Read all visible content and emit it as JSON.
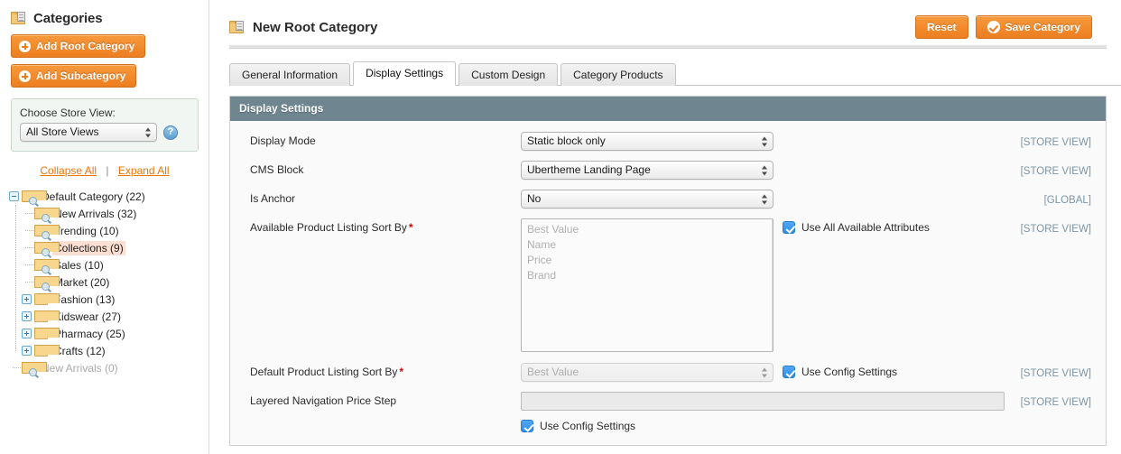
{
  "sidebar": {
    "heading": "Categories",
    "heading_icon": "folder-page-icon",
    "add_root_label": "Add Root Category",
    "add_sub_label": "Add Subcategory",
    "store_view": {
      "label": "Choose Store View:",
      "selected": "All Store Views",
      "options": [
        "All Store Views"
      ],
      "help_icon": "question-mark-icon"
    },
    "collapse_all": "Collapse All",
    "expand_all": "Expand All",
    "separator": "|",
    "tree": [
      {
        "label": "Default Category (22)",
        "depth": 0,
        "expander": "minus",
        "icon": "folder-search-icon",
        "selected": false,
        "muted": false
      },
      {
        "label": "New Arrivals (32)",
        "depth": 1,
        "expander": "none",
        "icon": "folder-search-icon",
        "selected": false,
        "muted": false
      },
      {
        "label": "Trending (10)",
        "depth": 1,
        "expander": "none",
        "icon": "folder-search-icon",
        "selected": false,
        "muted": false
      },
      {
        "label": "Collections (9)",
        "depth": 1,
        "expander": "none",
        "icon": "folder-search-icon",
        "selected": true,
        "muted": false
      },
      {
        "label": "Sales (10)",
        "depth": 1,
        "expander": "none",
        "icon": "folder-search-icon",
        "selected": false,
        "muted": false
      },
      {
        "label": "Market (20)",
        "depth": 1,
        "expander": "none",
        "icon": "folder-search-icon",
        "selected": false,
        "muted": false
      },
      {
        "label": "Fashion (13)",
        "depth": 1,
        "expander": "plus",
        "icon": "folder-icon",
        "selected": false,
        "muted": false
      },
      {
        "label": "Kidswear (27)",
        "depth": 1,
        "expander": "plus",
        "icon": "folder-icon",
        "selected": false,
        "muted": false
      },
      {
        "label": "Pharmacy (25)",
        "depth": 1,
        "expander": "plus",
        "icon": "folder-icon",
        "selected": false,
        "muted": false
      },
      {
        "label": "Crafts (12)",
        "depth": 1,
        "expander": "plus",
        "icon": "folder-icon",
        "selected": false,
        "muted": false
      },
      {
        "label": "New Arrivals (0)",
        "depth": 0,
        "expander": "none",
        "icon": "folder-search-icon",
        "selected": false,
        "muted": true
      }
    ]
  },
  "header": {
    "title": "New Root Category",
    "title_icon": "folder-page-icon",
    "reset_label": "Reset",
    "save_label": "Save Category",
    "save_icon": "check-circle-icon"
  },
  "tabs": [
    {
      "label": "General Information",
      "active": false
    },
    {
      "label": "Display Settings",
      "active": true
    },
    {
      "label": "Custom Design",
      "active": false
    },
    {
      "label": "Category Products",
      "active": false
    }
  ],
  "fieldset": {
    "title": "Display Settings",
    "rows": {
      "display_mode": {
        "label": "Display Mode",
        "value": "Static block only",
        "options": [
          "Static block only"
        ],
        "scope": "[STORE VIEW]"
      },
      "cms_block": {
        "label": "CMS Block",
        "value": "Ubertheme Landing Page",
        "options": [
          "Ubertheme Landing Page"
        ],
        "scope": "[STORE VIEW]"
      },
      "is_anchor": {
        "label": "Is Anchor",
        "value": "No",
        "options": [
          "No"
        ],
        "scope": "[GLOBAL]"
      },
      "available_sort": {
        "label": "Available Product Listing Sort By",
        "required": "*",
        "options": [
          "Best Value",
          "Name",
          "Price",
          "Brand"
        ],
        "checkbox_label": "Use All Available Attributes",
        "checked": true,
        "scope": "[STORE VIEW]"
      },
      "default_sort": {
        "label": "Default Product Listing Sort By",
        "required": "*",
        "value": "Best Value",
        "options": [
          "Best Value"
        ],
        "checkbox_label": "Use Config Settings",
        "checked": true,
        "scope": "[STORE VIEW]"
      },
      "price_step": {
        "label": "Layered Navigation Price Step",
        "value": "",
        "placeholder": "",
        "checkbox_label": "Use Config Settings",
        "checked": true,
        "scope": "[STORE VIEW]"
      }
    }
  },
  "colors": {
    "accent_orange": "#ec7e20",
    "fieldset_header": "#6f8691",
    "selected_node": "#fadfd2",
    "scope_text": "#7b95a6",
    "checkbox_blue": "#2d8de8",
    "required_red": "#d40707"
  }
}
